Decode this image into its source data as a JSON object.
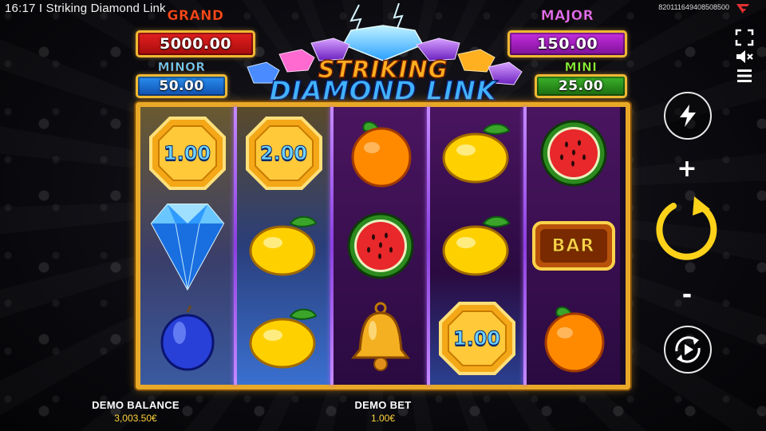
{
  "window": {
    "title": "16:17 I Striking Diamond Link",
    "game_id": "820111649408508500"
  },
  "logo": {
    "line1": "STRIKING",
    "line2": "DIAMOND LINK"
  },
  "jackpots": {
    "grand": {
      "label": "GRAND",
      "value": "5000.00"
    },
    "major": {
      "label": "MAJOR",
      "value": "150.00"
    },
    "minor": {
      "label": "MINOR",
      "value": "50.00"
    },
    "mini": {
      "label": "MINI",
      "value": "25.00"
    }
  },
  "reels": [
    [
      "coin:1.00",
      "diamond",
      "plum"
    ],
    [
      "coin:2.00",
      "lemon",
      "lemon"
    ],
    [
      "orange",
      "watermelon",
      "bell"
    ],
    [
      "lemon",
      "lemon",
      "coin:1.00"
    ],
    [
      "watermelon",
      "bar",
      "orange"
    ]
  ],
  "symbols": {
    "coin_values": {
      "r0c0": "1.00",
      "r0c1": "2.00",
      "r2c3": "1.00"
    },
    "bar_label": "BAR"
  },
  "controls": {
    "turbo_icon": "lightning-icon",
    "increase_label": "+",
    "decrease_label": "-",
    "spin_icon": "spin-arrow-icon",
    "autoplay_icon": "autoplay-icon",
    "fullscreen_icon": "fullscreen-icon",
    "sound_icon": "mute-icon",
    "menu_icon": "menu-icon"
  },
  "footer": {
    "balance_label": "DEMO BALANCE",
    "balance_value": "3,003.50€",
    "bet_label": "DEMO BET",
    "bet_value": "1.00€"
  },
  "colors": {
    "frame_gold": "#e9a928",
    "grand": "#e52020",
    "major": "#c52ee0",
    "minor": "#2a8ff0",
    "mini": "#3cb52a",
    "value_yellow": "#ffd23a"
  }
}
